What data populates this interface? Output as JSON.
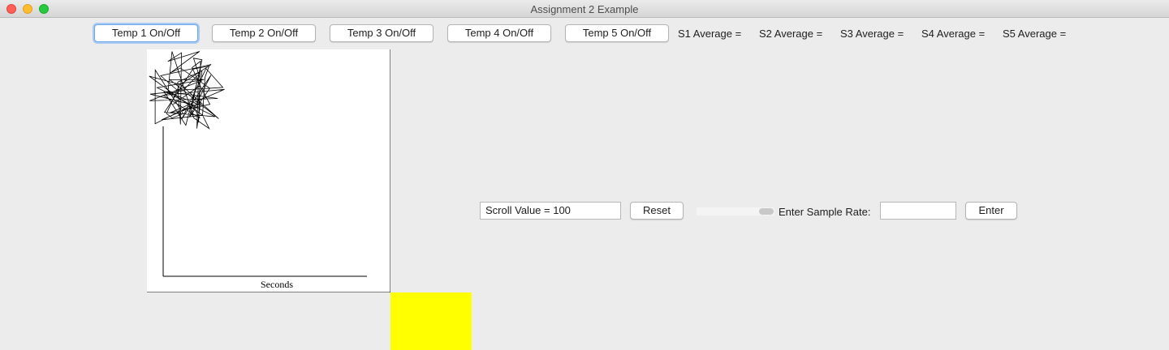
{
  "window": {
    "title": "Assignment 2 Example"
  },
  "toolbar": {
    "buttons": [
      "Temp 1 On/Off",
      "Temp 2 On/Off",
      "Temp 3 On/Off",
      "Temp 4 On/Off",
      "Temp 5 On/Off"
    ],
    "averages": [
      "S1 Average =",
      "S2 Average =",
      "S3 Average =",
      "S4 Average =",
      "S5 Average ="
    ]
  },
  "chart": {
    "xlabel": "Seconds"
  },
  "controls": {
    "scroll_value": "Scroll Value = 100",
    "reset_label": "Reset",
    "sample_rate_label": "Enter Sample Rate:",
    "sample_rate_value": "",
    "enter_label": "Enter",
    "slider_value": 100
  },
  "colors": {
    "swatch": "#ffff00",
    "focus": "#6ea7e8"
  }
}
